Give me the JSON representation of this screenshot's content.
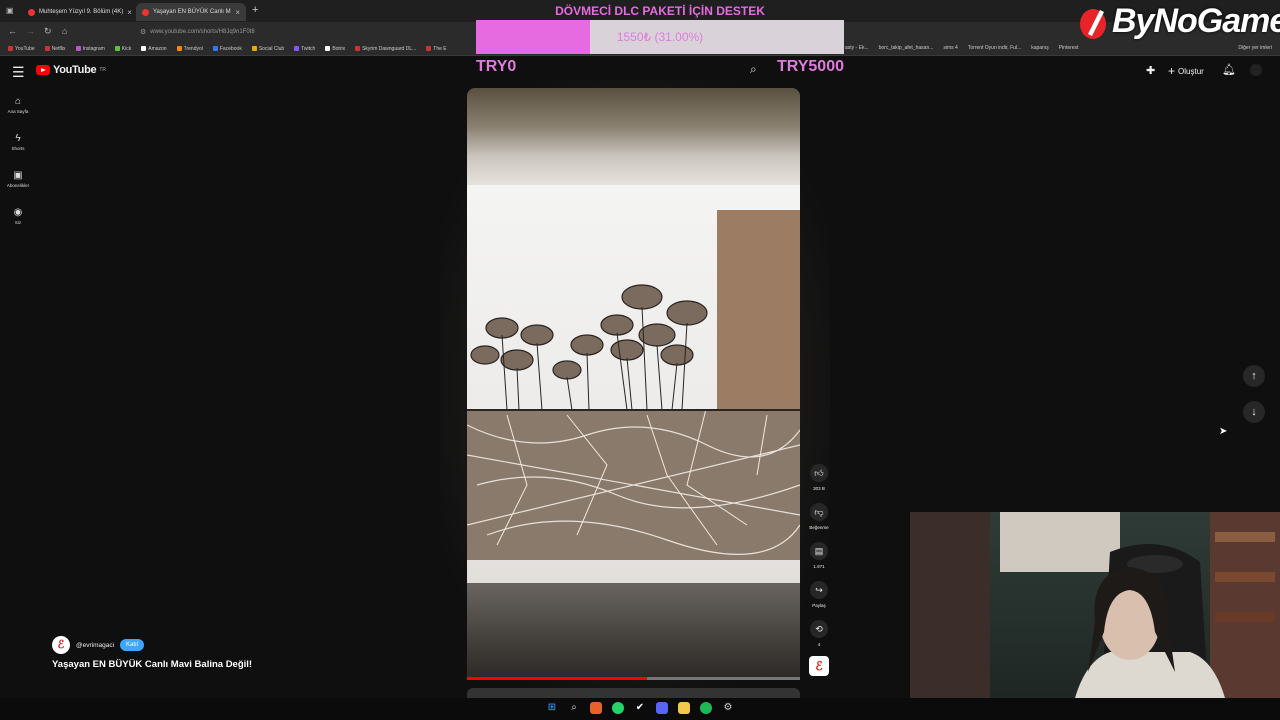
{
  "browser": {
    "tabs": [
      {
        "title": "Muhteşem Yüzyıl 9. Bölüm (4K)",
        "active": false
      },
      {
        "title": "Yaşayan EN BÜYÜK Canlı M",
        "active": true
      }
    ],
    "url": "www.youtube.com/shorts/H8Jq9n1F0t8",
    "bookmarks": [
      "YouTube",
      "Netflix",
      "Instagram",
      "Kick",
      "Amazon",
      "Trendyol",
      "Facebook",
      "Social Club",
      "Twitch",
      "Botrix",
      "Skyrim Dawnguard DL...",
      "The E"
    ],
    "bookmarks_right": [
      "asty - Ek...",
      "borc_takip_afet_hasan...",
      "sims 4",
      "Torrent Oyun indir, Ful...",
      "kapanış",
      "Pinterest"
    ],
    "other_bookmarks": "Diğer yer imleri"
  },
  "youtube": {
    "logo_text": "YouTube",
    "logo_region": "TR",
    "create_label": "Oluştur",
    "sidebar": [
      {
        "label": "Ana Sayfa",
        "icon": "home-icon"
      },
      {
        "label": "Shorts",
        "icon": "shorts-icon"
      },
      {
        "label": "Abonelikler",
        "icon": "subscriptions-icon"
      },
      {
        "label": "Siz",
        "icon": "you-icon"
      }
    ]
  },
  "overlay": {
    "title": "DÖVMECİ DLC PAKETİ İÇİN DESTEK",
    "progress_text": "1550₺ (31.00%)",
    "progress_fraction": 0.31,
    "min_label": "TRY0",
    "max_label": "TRY5000",
    "brand": "ByNoGame",
    "accent": "#e66be0"
  },
  "short": {
    "likes": "303 B",
    "dislike_label": "Beğenme",
    "comments": "1.971",
    "share_label": "Paylaş",
    "remix_count": "4",
    "channel": "@evrimagaci",
    "subscribe_label": "Katıl",
    "title": "Yaşayan EN BÜYÜK Canlı Mavi Balina Değil!",
    "progress_fraction": 0.54
  }
}
